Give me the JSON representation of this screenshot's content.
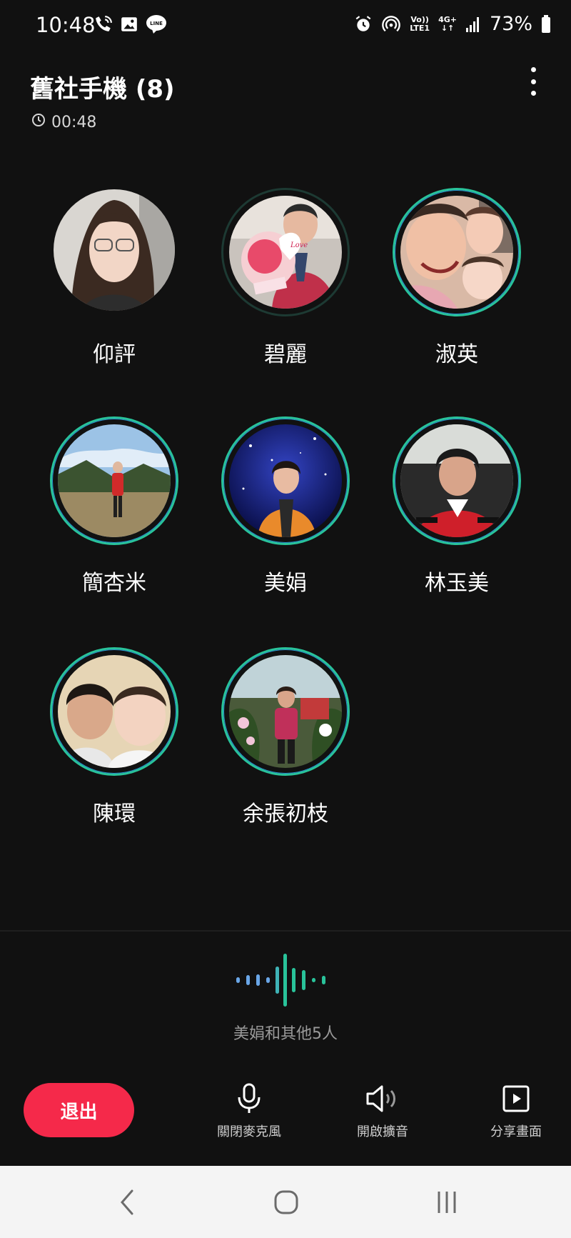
{
  "status_bar": {
    "time": "10:48",
    "left_icons": [
      "phone-call-icon",
      "image-icon",
      "line-app-icon"
    ],
    "right_icons": [
      "alarm-icon",
      "hotspot-icon",
      "volte-icon",
      "network-4g-icon",
      "signal-icon",
      "battery-icon"
    ],
    "volte_line1": "Vo))",
    "volte_line2": "LTE1",
    "net_line1": "4G+",
    "net_line2": "↓↑",
    "battery": "73%"
  },
  "header": {
    "title": "舊社手機 (8)",
    "timer": "00:48",
    "timer_icon": "clock-icon",
    "menu_icon": "more-vertical-icon"
  },
  "participants": [
    {
      "name": "仰評",
      "ring": "none"
    },
    {
      "name": "碧麗",
      "ring": "dim"
    },
    {
      "name": "淑英",
      "ring": "speaking"
    },
    {
      "name": "簡杏米",
      "ring": "speaking"
    },
    {
      "name": "美娟",
      "ring": "speaking"
    },
    {
      "name": "林玉美",
      "ring": "speaking"
    },
    {
      "name": "陳環",
      "ring": "speaking"
    },
    {
      "name": "余張初枝",
      "ring": "speaking"
    }
  ],
  "speaking_label": "美娟和其他5人",
  "controls": {
    "exit": "退出",
    "mic": "關閉麥克風",
    "speaker": "開啟擴音",
    "share": "分享畫面"
  },
  "nav": [
    "back-icon",
    "home-icon",
    "recents-icon"
  ],
  "colors": {
    "background": "#111111",
    "accent_green": "#29c39a",
    "accent_blue": "#6aa7e8",
    "exit_red": "#f5294a"
  }
}
